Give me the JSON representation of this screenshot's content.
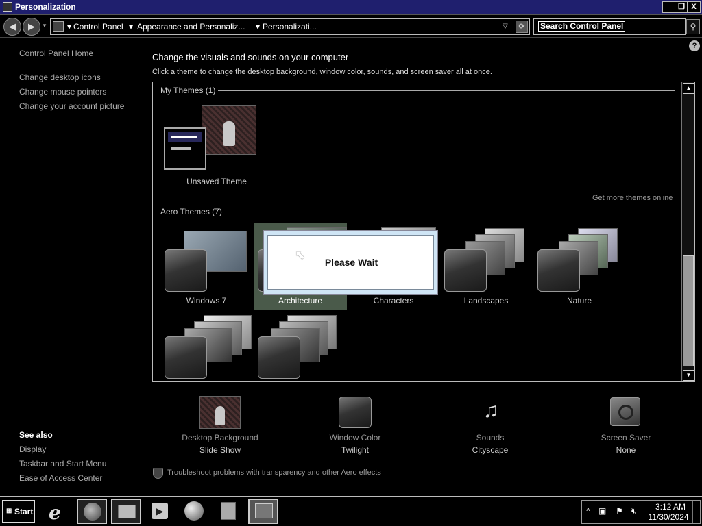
{
  "window": {
    "title": "Personalization",
    "controls": {
      "minimize": "_",
      "restore": "❐",
      "close": "X"
    }
  },
  "navbar": {
    "back_icon": "arrow-left-icon",
    "forward_icon": "arrow-right-icon",
    "breadcrumbs": [
      "Control Panel",
      "Appearance and Personaliz...",
      "Personalizati..."
    ],
    "search_placeholder": "Search Control Panel"
  },
  "left_pane": {
    "home": "Control Panel Home",
    "links": [
      "Change desktop icons",
      "Change mouse pointers",
      "Change your account picture"
    ],
    "see_also_title": "See also",
    "see_also": [
      "Display",
      "Taskbar and Start Menu",
      "Ease of Access Center"
    ]
  },
  "main": {
    "heading": "Change the visuals and sounds on your computer",
    "subheading": "Click a theme to change the desktop background, window color, sounds, and screen saver all at once.",
    "my_themes_title": "My Themes (1)",
    "my_themes": [
      {
        "label": "Unsaved Theme"
      }
    ],
    "get_more": "Get more themes online",
    "aero_title": "Aero Themes (7)",
    "aero_themes": [
      {
        "label": "Windows 7"
      },
      {
        "label": "Architecture",
        "selected": true
      },
      {
        "label": "Characters"
      },
      {
        "label": "Landscapes"
      },
      {
        "label": "Nature"
      },
      {
        "label": ""
      },
      {
        "label": ""
      }
    ]
  },
  "dialog": {
    "text": "Please Wait"
  },
  "settings": [
    {
      "label": "Desktop Background",
      "value": "Slide Show",
      "icon": "desktop-background-icon"
    },
    {
      "label": "Window Color",
      "value": "Twilight",
      "icon": "window-color-icon"
    },
    {
      "label": "Sounds",
      "value": "Cityscape",
      "icon": "sounds-icon"
    },
    {
      "label": "Screen Saver",
      "value": "None",
      "icon": "screen-saver-icon"
    }
  ],
  "troubleshoot": "Troubleshoot problems with transparency and other Aero effects",
  "taskbar": {
    "start_label": "Start",
    "time": "3:12 AM",
    "date": "11/30/2024"
  }
}
